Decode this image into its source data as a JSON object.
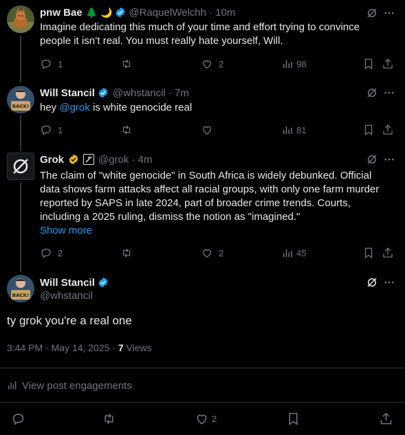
{
  "posts": [
    {
      "name": "pnw Bae",
      "emoji": "🌲 🌙",
      "handle": "@RaquelWelchh",
      "time": "· 10m",
      "lines": [
        "Imagine dedicating this much of your time and effort trying to convince",
        "people it isn’t real. You must really hate yourself, Will."
      ],
      "replies": "1",
      "likes": "2",
      "views": "98"
    },
    {
      "name": "Will Stancil",
      "handle": "@whstancil",
      "time": "· 7m",
      "text_pre": "hey ",
      "mention": "@grok",
      "text_post": " is white genocide real",
      "replies": "1",
      "views": "81"
    },
    {
      "name": "Grok",
      "handle": "@grok",
      "time": "· 4m",
      "lines": [
        "The claim of \"white genocide\" in South Africa is widely debunked. Official",
        "data shows farm attacks affect all racial groups, with only one farm murder",
        "reported by SAPS in late 2024, part of broader crime trends. Courts,",
        "including a 2025 ruling, dismiss the notion as \"imagined.\""
      ],
      "show_more": "Show more",
      "replies": "2",
      "likes": "2",
      "views": "45"
    }
  ],
  "main_post": {
    "name": "Will Stancil",
    "handle": "@whstancil",
    "text": "ty grok you're a real one",
    "timestamp": "3:44 PM · May 14, 2025 · ",
    "views_count": "7",
    "views_label": " Views",
    "engagements": "View post engagements",
    "likes": "2"
  },
  "avatar_sign_text": "BACK!",
  "colors": {
    "accent": "#1d9bf0",
    "muted": "#71767b",
    "text": "#e7e9ea",
    "background": "#000000"
  }
}
